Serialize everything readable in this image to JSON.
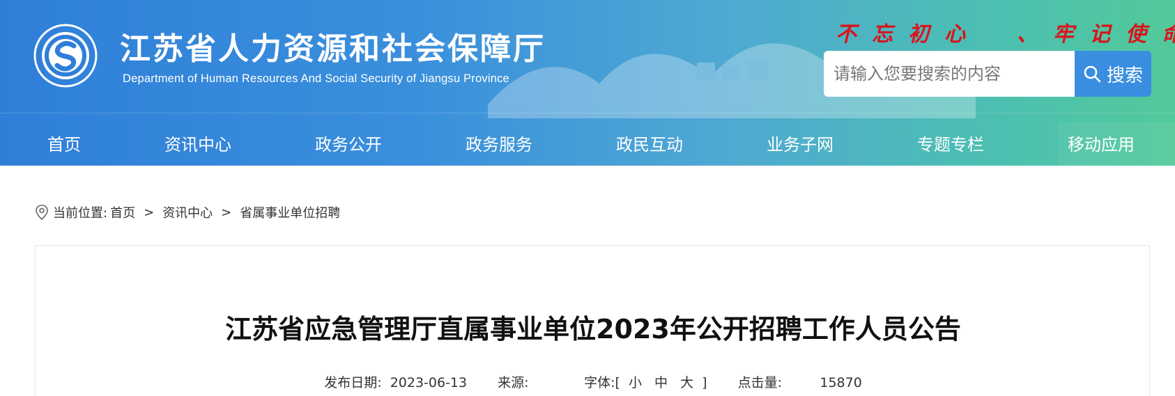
{
  "header": {
    "title": "江苏省人力资源和社会保障厅",
    "subtitle": "Department of Human Resources And Social Security of Jiangsu Province",
    "slogan_chars": [
      "不",
      "忘",
      "初",
      "心",
      "",
      "、",
      "牢",
      "记",
      "使",
      "命"
    ],
    "logo_icon": "jiangsu-hrss-logo-icon",
    "colors": {
      "gradient_start": "#2f7fd9",
      "gradient_end": "#52c99a",
      "slogan": "#d9141c",
      "search_button": "#3a8ee0"
    }
  },
  "search": {
    "placeholder": "请输入您要搜索的内容",
    "button_label": "搜索",
    "icon": "search-icon"
  },
  "nav": {
    "items": [
      "首页",
      "资讯中心",
      "政务公开",
      "政务服务",
      "政民互动",
      "业务子网",
      "专题专栏",
      "移动应用"
    ]
  },
  "breadcrumb": {
    "icon": "location-pin-icon",
    "label": "当前位置:",
    "items": [
      "首页",
      "资讯中心",
      "省属事业单位招聘"
    ],
    "separator": ">"
  },
  "article": {
    "title": "江苏省应急管理厅直属事业单位2023年公开招聘工作人员公告",
    "meta": {
      "date_label": "发布日期:",
      "date": "2023-06-13",
      "source_label": "来源:",
      "source": "",
      "font_label": "字体:",
      "bracket_open": "[",
      "font_small": "小",
      "font_medium": "中",
      "font_large": "大",
      "bracket_close": "]",
      "clicks_label": "点击量:",
      "clicks": "15870"
    }
  }
}
